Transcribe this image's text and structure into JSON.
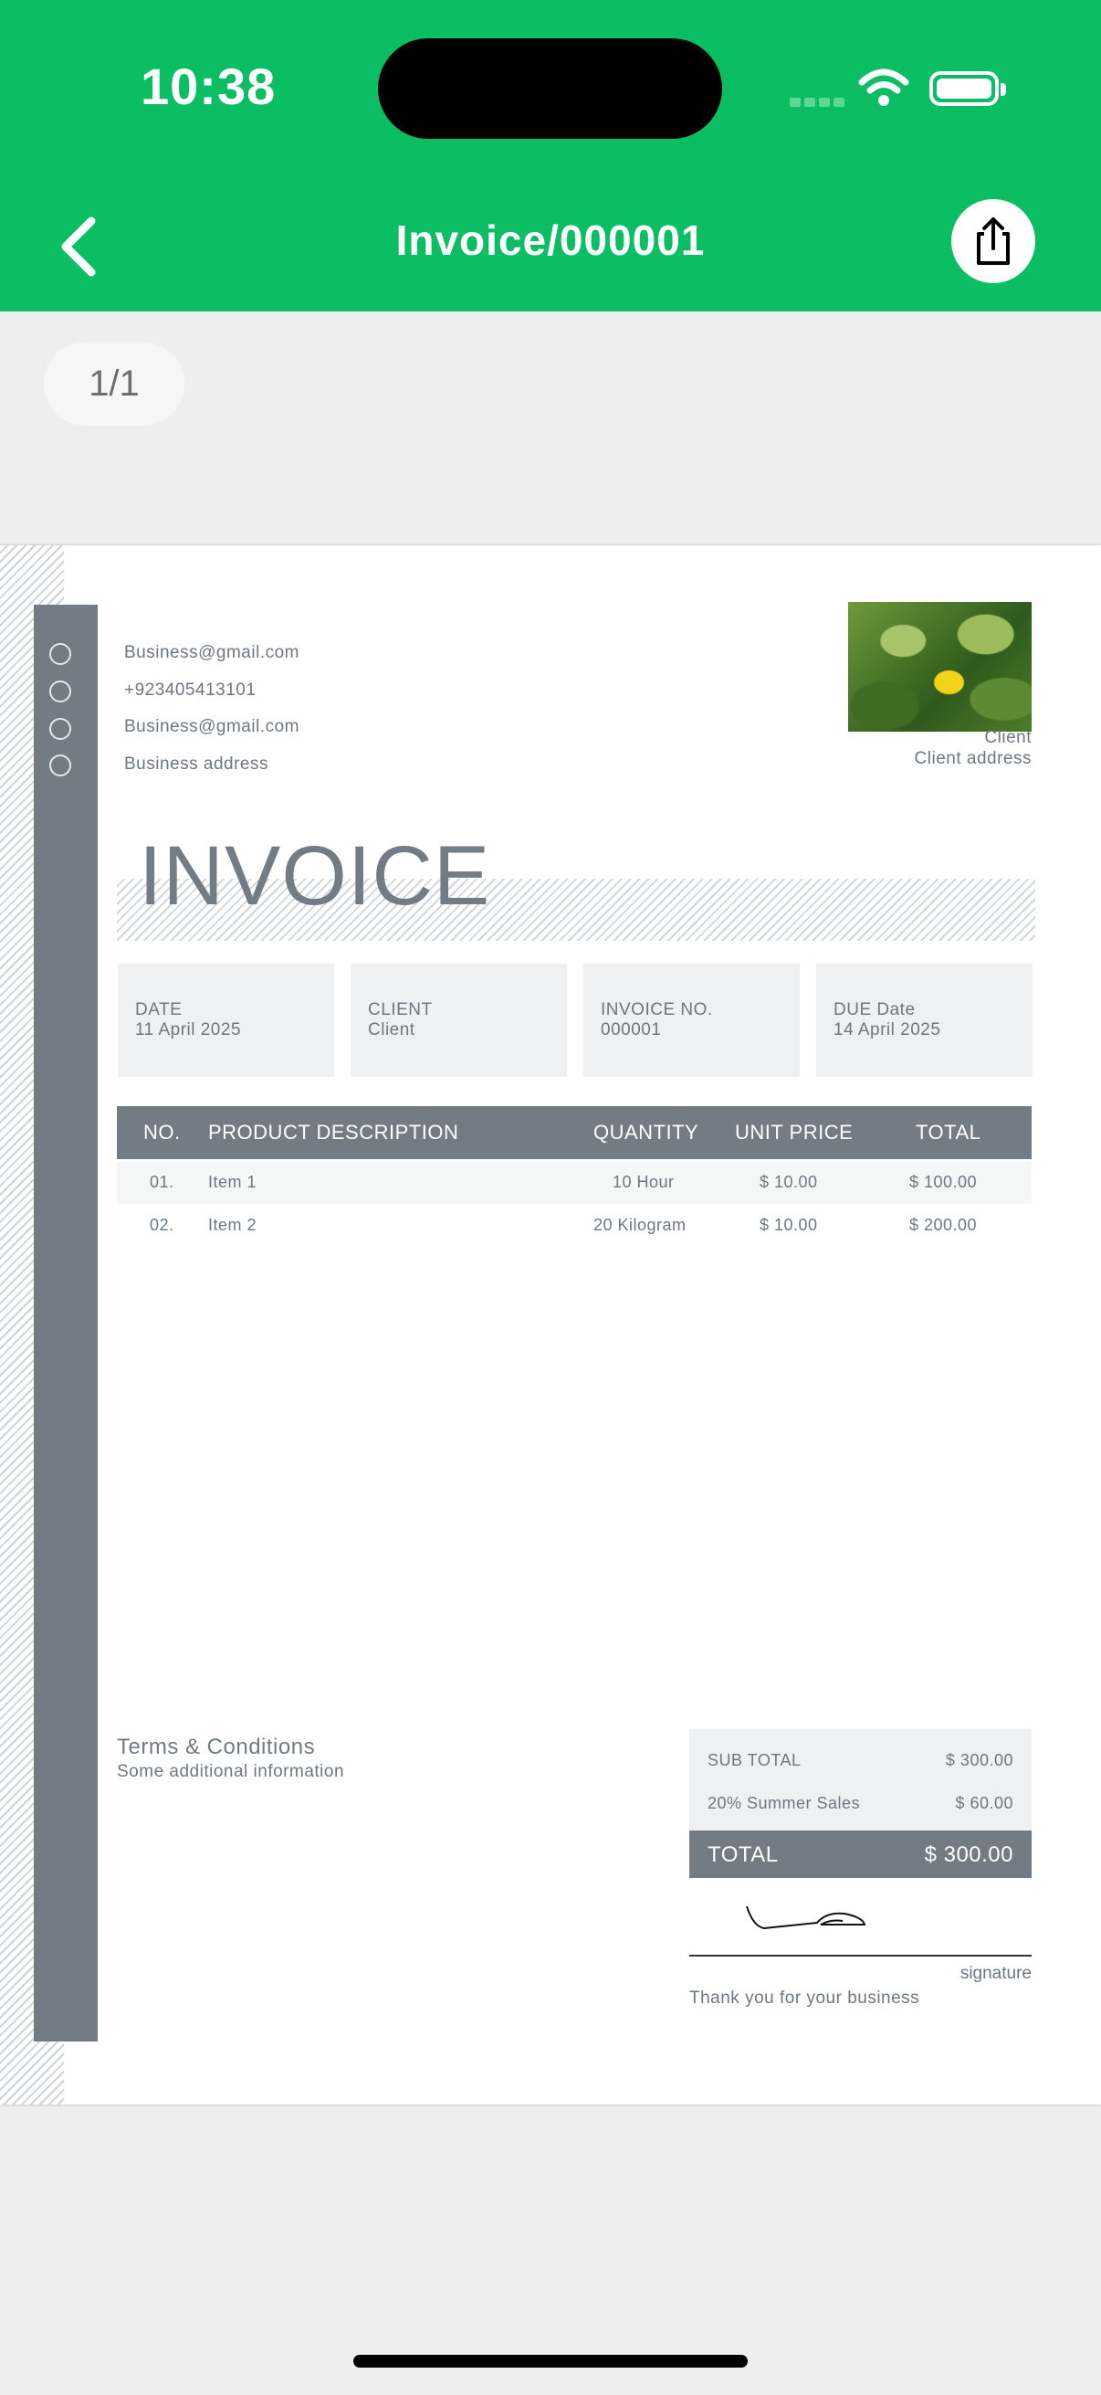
{
  "status": {
    "time": "10:38"
  },
  "nav": {
    "title": "Invoice/000001",
    "back_icon": "chevron-left-icon",
    "share_icon": "share-icon"
  },
  "pager": {
    "label": "1/1"
  },
  "invoice": {
    "contact": {
      "email": "Business@gmail.com",
      "phone": "+923405413101",
      "website": "Business@gmail.com",
      "address": "Business address"
    },
    "client_name": "Client",
    "client_address": "Client address",
    "heading": "INVOICE",
    "info": {
      "date_label": "DATE",
      "date_value": "11 April 2025",
      "client_label": "CLIENT",
      "client_value": "Client",
      "number_label": "INVOICE NO.",
      "number_value": "000001",
      "due_label": "DUE Date",
      "due_value": "14 April 2025"
    },
    "table": {
      "headers": [
        "NO.",
        "PRODUCT DESCRIPTION",
        "QUANTITY",
        "UNIT PRICE",
        "TOTAL"
      ],
      "rows": [
        [
          "01.",
          "Item 1",
          "10 Hour",
          "$ 10.00",
          "$ 100.00"
        ],
        [
          "02.",
          "Item 2",
          "20 Kilogram",
          "$ 10.00",
          "$ 200.00"
        ]
      ]
    },
    "terms_title": "Terms & Conditions",
    "terms_text": "Some additional information",
    "totals": {
      "subtotal_label": "SUB TOTAL",
      "subtotal_value": "$ 300.00",
      "discount_label": "20% Summer Sales",
      "discount_value": "$ 60.00",
      "total_label": "TOTAL",
      "total_value": "$ 300.00"
    },
    "signature_label": "signature",
    "thanks": "Thank you for your business"
  },
  "colors": {
    "brand": "#0bbd63",
    "invoice_accent": "#737b84"
  }
}
